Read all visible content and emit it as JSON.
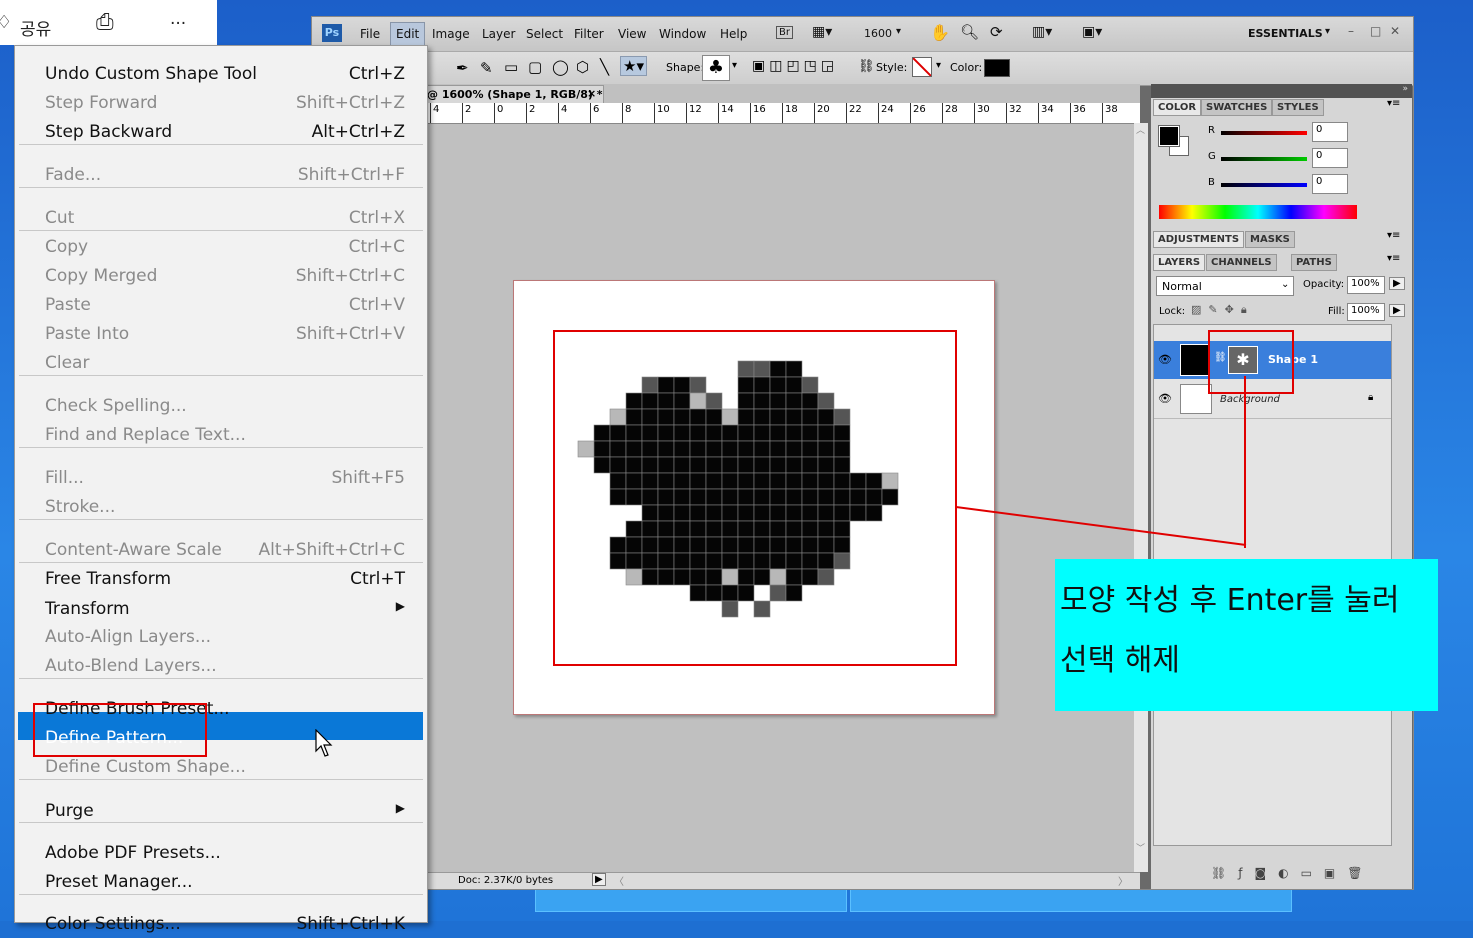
{
  "korean_toolbar": {
    "share_label": "공유",
    "more_label": "···"
  },
  "ps": {
    "logo": "Ps",
    "menu": [
      "File",
      "Edit",
      "Image",
      "Layer",
      "Select",
      "Filter",
      "View",
      "Window",
      "Help"
    ],
    "zoom_menu": "1600",
    "workspace": "ESSENTIALS",
    "window_controls": [
      "–",
      "□",
      "✕"
    ],
    "options": {
      "shape_label": "Shape:",
      "style_label": "Style:",
      "color_label": "Color:"
    },
    "doc_tab": "@ 1600% (Shape 1, RGB/8) *",
    "doc_tab_close": "×",
    "ruler_ticks": [
      "4",
      "2",
      "0",
      "2",
      "4",
      "6",
      "8",
      "10",
      "12",
      "14",
      "16",
      "18",
      "20",
      "22",
      "24",
      "26",
      "28",
      "30",
      "32",
      "34",
      "36",
      "38"
    ],
    "status": "Doc: 2.37K/0 bytes",
    "colors": {
      "accent": "#0a78d7",
      "highlight_box": "#e00000",
      "callout_bg": "#00ffff"
    }
  },
  "panels": {
    "color_tabs": [
      "COLOR",
      "SWATCHES",
      "STYLES"
    ],
    "channels": [
      {
        "label": "R",
        "value": "0"
      },
      {
        "label": "G",
        "value": "0"
      },
      {
        "label": "B",
        "value": "0"
      }
    ],
    "adj_tabs": [
      "ADJUSTMENTS",
      "MASKS"
    ],
    "layer_tabs": [
      "LAYERS",
      "CHANNELS",
      "PATHS"
    ],
    "blend_mode": "Normal",
    "opacity_label": "Opacity:",
    "opacity_value": "100%",
    "lock_label": "Lock:",
    "fill_label": "Fill:",
    "fill_value": "100%",
    "layers": [
      {
        "name": "Shape 1",
        "selected": true
      },
      {
        "name": "Background",
        "selected": false
      }
    ]
  },
  "edit_menu": {
    "items": [
      {
        "label": "Undo Custom Shape Tool",
        "shortcut": "Ctrl+Z",
        "enabled": true
      },
      {
        "label": "Step Forward",
        "shortcut": "Shift+Ctrl+Z",
        "enabled": false
      },
      {
        "label": "Step Backward",
        "shortcut": "Alt+Ctrl+Z",
        "enabled": true
      },
      {
        "label": "Fade...",
        "shortcut": "Shift+Ctrl+F",
        "enabled": false
      },
      {
        "label": "Cut",
        "shortcut": "Ctrl+X",
        "enabled": false
      },
      {
        "label": "Copy",
        "shortcut": "Ctrl+C",
        "enabled": false
      },
      {
        "label": "Copy Merged",
        "shortcut": "Shift+Ctrl+C",
        "enabled": false
      },
      {
        "label": "Paste",
        "shortcut": "Ctrl+V",
        "enabled": false
      },
      {
        "label": "Paste Into",
        "shortcut": "Shift+Ctrl+V",
        "enabled": false
      },
      {
        "label": "Clear",
        "shortcut": "",
        "enabled": false
      },
      {
        "label": "Check Spelling...",
        "shortcut": "",
        "enabled": false
      },
      {
        "label": "Find and Replace Text...",
        "shortcut": "",
        "enabled": false
      },
      {
        "label": "Fill...",
        "shortcut": "Shift+F5",
        "enabled": false
      },
      {
        "label": "Stroke...",
        "shortcut": "",
        "enabled": false
      },
      {
        "label": "Content-Aware Scale",
        "shortcut": "Alt+Shift+Ctrl+C",
        "enabled": false
      },
      {
        "label": "Free Transform",
        "shortcut": "Ctrl+T",
        "enabled": true
      },
      {
        "label": "Transform",
        "shortcut": "",
        "enabled": true,
        "submenu": true
      },
      {
        "label": "Auto-Align Layers...",
        "shortcut": "",
        "enabled": false
      },
      {
        "label": "Auto-Blend Layers...",
        "shortcut": "",
        "enabled": false
      },
      {
        "label": "Define Brush Preset...",
        "shortcut": "",
        "enabled": true
      },
      {
        "label": "Define Pattern...",
        "shortcut": "",
        "enabled": true,
        "highlighted": true
      },
      {
        "label": "Define Custom Shape...",
        "shortcut": "",
        "enabled": false
      },
      {
        "label": "Purge",
        "shortcut": "",
        "enabled": true,
        "submenu": true
      },
      {
        "label": "Adobe PDF Presets...",
        "shortcut": "",
        "enabled": true
      },
      {
        "label": "Preset Manager...",
        "shortcut": "",
        "enabled": true
      },
      {
        "label": "Color Settings...",
        "shortcut": "Shift+Ctrl+K",
        "enabled": true
      }
    ]
  },
  "callout": {
    "line1": "모양 작성 후 Enter를 눌러",
    "line2": "선택 해제"
  }
}
